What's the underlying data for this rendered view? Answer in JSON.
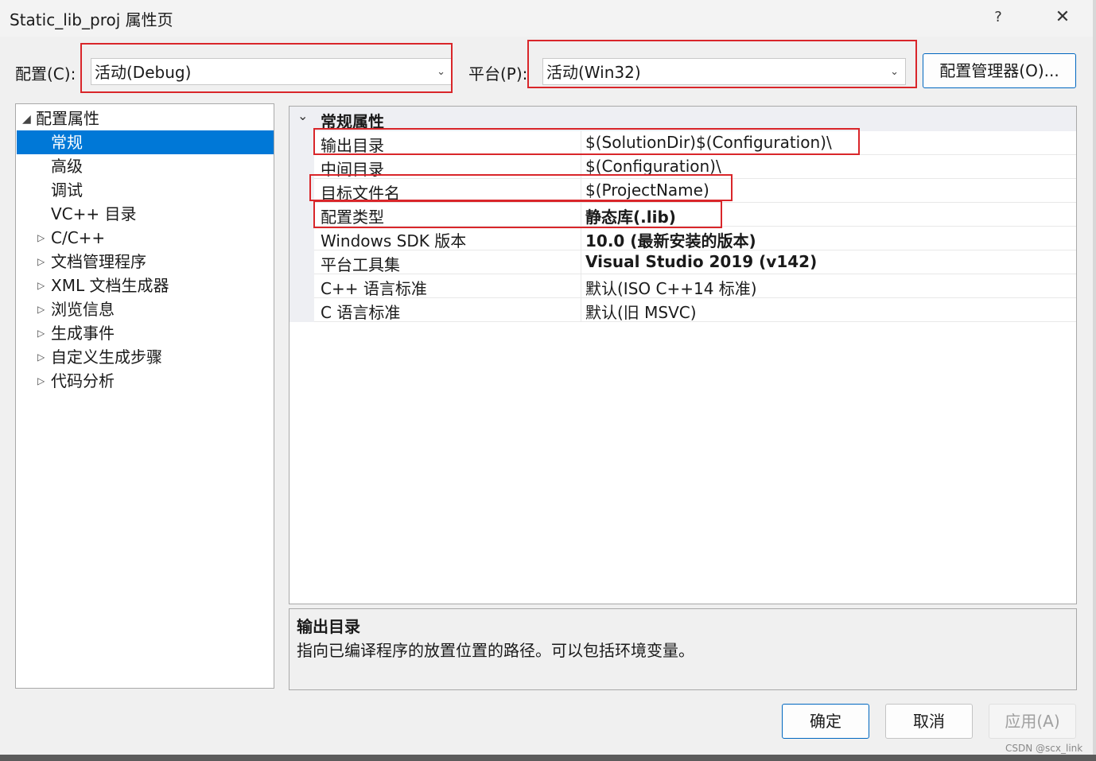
{
  "window": {
    "title": "Static_lib_proj 属性页",
    "help_icon": "?",
    "close_icon": "✕"
  },
  "toolbar": {
    "config_label": "配置(C):",
    "config_value": "活动(Debug)",
    "platform_label": "平台(P):",
    "platform_value": "活动(Win32)",
    "config_manager_label": "配置管理器(O)..."
  },
  "tree": {
    "root": "配置属性",
    "items": [
      "常规",
      "高级",
      "调试",
      "VC++ 目录",
      "C/C++",
      "文档管理程序",
      "XML 文档生成器",
      "浏览信息",
      "生成事件",
      "自定义生成步骤",
      "代码分析"
    ],
    "selected": "常规"
  },
  "grid": {
    "category": "常规属性",
    "rows": [
      {
        "name": "输出目录",
        "value": "$(SolutionDir)$(Configuration)\\"
      },
      {
        "name": "中间目录",
        "value": "$(Configuration)\\"
      },
      {
        "name": "目标文件名",
        "value": "$(ProjectName)"
      },
      {
        "name": "配置类型",
        "value": "静态库(.lib)"
      },
      {
        "name": "Windows SDK 版本",
        "value": "10.0 (最新安装的版本)"
      },
      {
        "name": "平台工具集",
        "value": "Visual Studio 2019 (v142)"
      },
      {
        "name": "C++ 语言标准",
        "value": "默认(ISO C++14 标准)"
      },
      {
        "name": "C 语言标准",
        "value": "默认(旧 MSVC)"
      }
    ]
  },
  "description": {
    "title": "输出目录",
    "text": "指向已编译程序的放置位置的路径。可以包括环境变量。"
  },
  "buttons": {
    "ok": "确定",
    "cancel": "取消",
    "apply": "应用(A)"
  },
  "watermark": "CSDN @scx_link",
  "colors": {
    "highlight": "#d9262a",
    "selection": "#0078d7",
    "accent_border": "#0067c0"
  }
}
